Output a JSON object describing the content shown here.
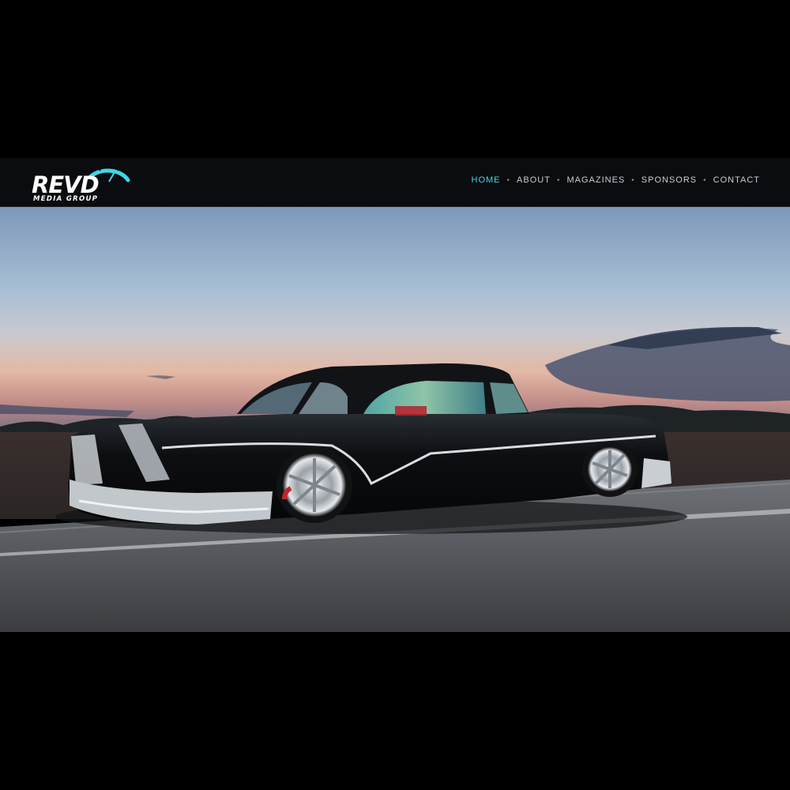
{
  "brand": {
    "logo_main": "REVD",
    "logo_tagline": "MEDIA GROUP",
    "accent_color": "#3fd6e8"
  },
  "nav": {
    "items": [
      {
        "label": "HOME",
        "active": true
      },
      {
        "label": "ABOUT",
        "active": false
      },
      {
        "label": "MAGAZINES",
        "active": false
      },
      {
        "label": "SPONSORS",
        "active": false
      },
      {
        "label": "CONTACT",
        "active": false
      }
    ],
    "separator": "•"
  },
  "hero": {
    "subject": "black custom lowrider classic car on a road at dusk"
  }
}
